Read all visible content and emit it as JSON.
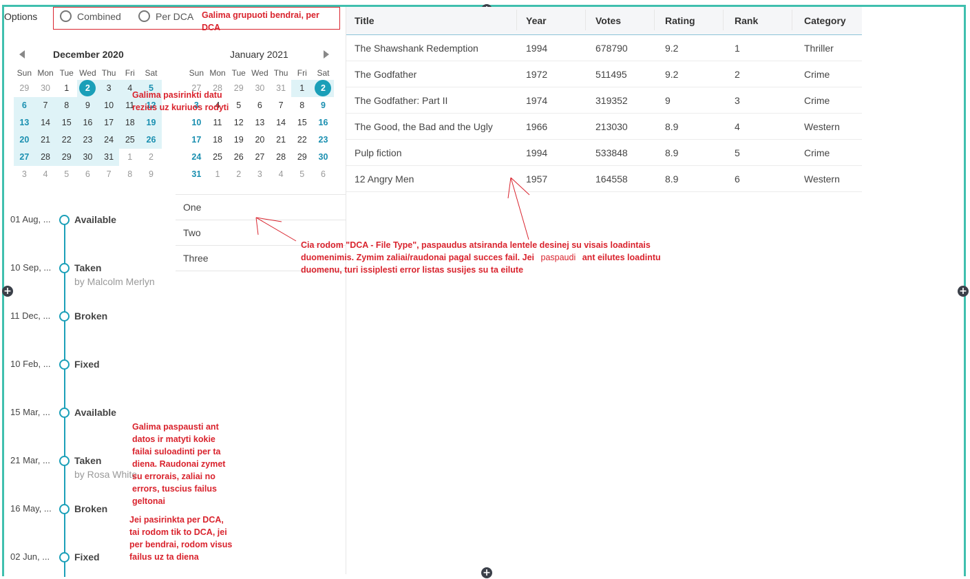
{
  "options": {
    "label": "Options",
    "radios": [
      "Combined",
      "Per DCA"
    ]
  },
  "calendars": [
    {
      "title": "December 2020",
      "dow": [
        "Sun",
        "Mon",
        "Tue",
        "Wed",
        "Thu",
        "Fri",
        "Sat"
      ],
      "weeks": [
        [
          "29",
          "30",
          "1",
          "2",
          "3",
          "4",
          "5"
        ],
        [
          "6",
          "7",
          "8",
          "9",
          "10",
          "11",
          "12"
        ],
        [
          "13",
          "14",
          "15",
          "16",
          "17",
          "18",
          "19"
        ],
        [
          "20",
          "21",
          "22",
          "23",
          "24",
          "25",
          "26"
        ],
        [
          "27",
          "28",
          "29",
          "30",
          "31",
          "1",
          "2"
        ],
        [
          "3",
          "4",
          "5",
          "6",
          "7",
          "8",
          "9"
        ]
      ]
    },
    {
      "title": "January 2021",
      "dow": [
        "Sun",
        "Mon",
        "Tue",
        "Wed",
        "Thu",
        "Fri",
        "Sat"
      ],
      "weeks": [
        [
          "27",
          "28",
          "29",
          "30",
          "31",
          "1",
          "2"
        ],
        [
          "3",
          "4",
          "5",
          "6",
          "7",
          "8",
          "9"
        ],
        [
          "10",
          "11",
          "12",
          "13",
          "14",
          "15",
          "16"
        ],
        [
          "17",
          "18",
          "19",
          "20",
          "21",
          "22",
          "23"
        ],
        [
          "24",
          "25",
          "26",
          "27",
          "28",
          "29",
          "30"
        ],
        [
          "31",
          "1",
          "2",
          "3",
          "4",
          "5",
          "6"
        ]
      ]
    }
  ],
  "timeline": [
    {
      "date": "01 Aug, ...",
      "status": "Available",
      "by": ""
    },
    {
      "date": "10 Sep, ...",
      "status": "Taken",
      "by": "by Malcolm Merlyn"
    },
    {
      "date": "11 Dec, ...",
      "status": "Broken",
      "by": ""
    },
    {
      "date": "10 Feb, ...",
      "status": "Fixed",
      "by": ""
    },
    {
      "date": "15 Mar, ...",
      "status": "Available",
      "by": ""
    },
    {
      "date": "21 Mar, ...",
      "status": "Taken",
      "by": "by Rosa White"
    },
    {
      "date": "16 May, ...",
      "status": "Broken",
      "by": ""
    },
    {
      "date": "02 Jun, ...",
      "status": "Fixed",
      "by": ""
    }
  ],
  "list": [
    "One",
    "Two",
    "Three"
  ],
  "table": {
    "headers": [
      "Title",
      "Year",
      "Votes",
      "Rating",
      "Rank",
      "Category"
    ],
    "rows": [
      [
        "The Shawshank Redemption",
        "1994",
        "678790",
        "9.2",
        "1",
        "Thriller"
      ],
      [
        "The Godfather",
        "1972",
        "511495",
        "9.2",
        "2",
        "Crime"
      ],
      [
        "The Godfather: Part II",
        "1974",
        "319352",
        "9",
        "3",
        "Crime"
      ],
      [
        "The Good, the Bad and the Ugly",
        "1966",
        "213030",
        "8.9",
        "4",
        "Western"
      ],
      [
        "Pulp fiction",
        "1994",
        "533848",
        "8.9",
        "5",
        "Crime"
      ],
      [
        "12 Angry Men",
        "1957",
        "164558",
        "8.9",
        "6",
        "Western"
      ]
    ]
  },
  "annotations": {
    "group": "Galima grupuoti bendrai, per DCA",
    "range": "Galima pasirinkti datu rezius uz kuriuos rodyti",
    "list_note": "Cia rodom \"DCA - File Type\", paspaudus atsiranda lentele desinej su visais loadintais duomenimis. Zymim zaliai/raudonai pagal succes fail. Jei",
    "list_note_word": "paspaudi",
    "list_note_end": "ant eilutes loadintu duomenu, turi issiplesti error listas susijes su ta eilute",
    "dates": "Galima paspausti ant datos ir matyti kokie failai suloadinti per ta diena. Raudonai zymet su errorais, zaliai no errors, tuscius failus geltonai",
    "dca": "Jei pasirinkta per DCA, tai rodom tik to DCA, jei per bendrai, rodom visus failus uz ta diena"
  },
  "colors": {
    "accent": "#1a9fb8",
    "frame": "#3fbfae",
    "annotation": "#d9232d"
  }
}
